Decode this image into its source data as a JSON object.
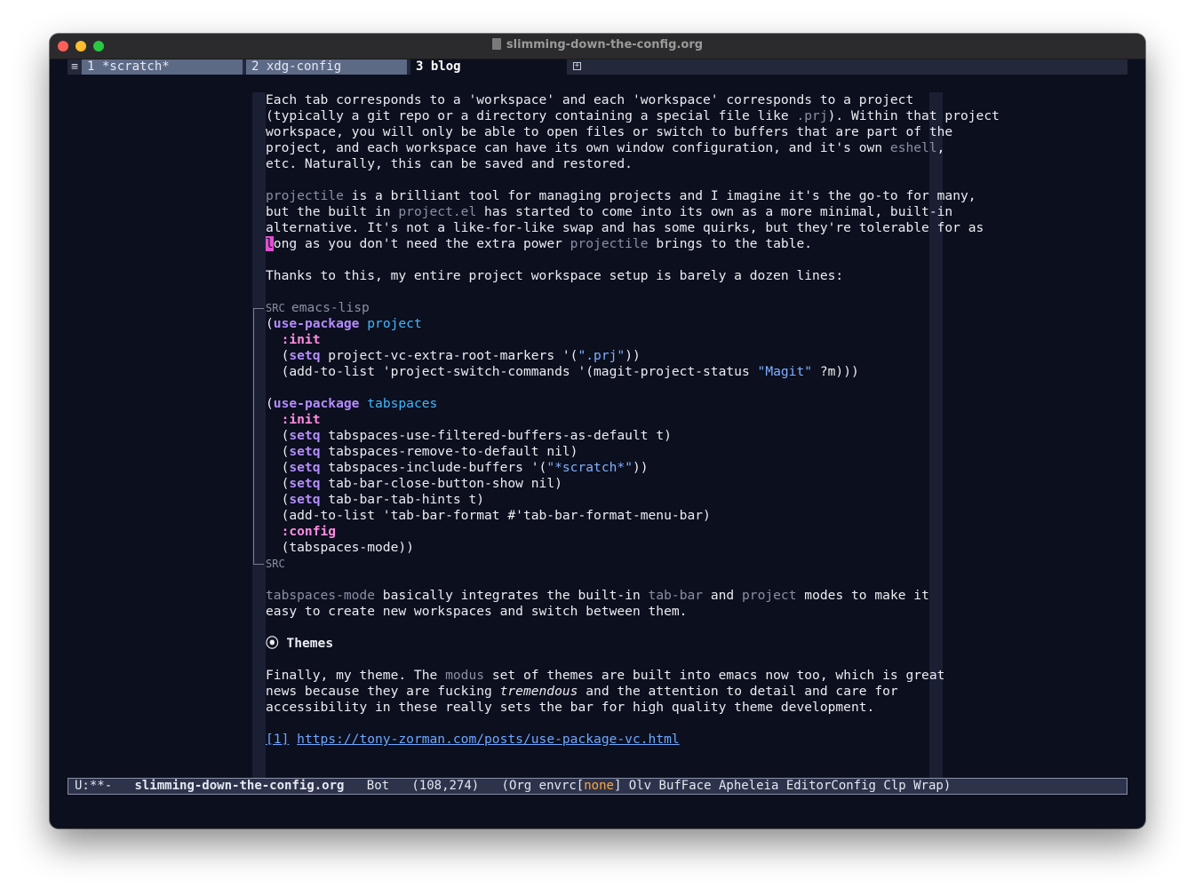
{
  "window": {
    "title": "slimming-down-the-config.org"
  },
  "tabs": [
    {
      "label": "1 *scratch*",
      "active": false
    },
    {
      "label": "2 xdg-config",
      "active": false
    },
    {
      "label": "3 blog",
      "active": true
    }
  ],
  "tabbar": {
    "menu_glyph": "≡",
    "add_glyph": "+"
  },
  "buffer": {
    "p1": [
      "Each tab corresponds to a 'workspace' and each 'workspace' corresponds to a project",
      [
        "(typically a git repo or a directory containing a special file like ",
        ".prj",
        "). Within that project"
      ],
      "workspace, you will only be able to open files or switch to buffers that are part of the",
      [
        "project, and each workspace can have its own window configuration, and it's own ",
        "eshell",
        ","
      ],
      "etc. Naturally, this can be saved and restored."
    ],
    "p2": [
      [
        "projectile",
        " is a brilliant tool for managing projects and I imagine it's the go-to for many,"
      ],
      [
        "but the built in ",
        "project.el",
        " has started to come into its own as a more minimal, built-in"
      ],
      "alternative. It's not a like-for-like swap and has some quirks, but they're tolerable for as",
      [
        "l",
        "ong as you don't need the extra power ",
        "projectile",
        " brings to the table."
      ]
    ],
    "p3": "Thanks to this, my entire project workspace setup is barely a dozen lines:",
    "src": {
      "begin_label": "SRC",
      "language": "emacs-lisp",
      "end_label": "SRC",
      "lines": [
        [
          "(",
          "use-package",
          " ",
          "project"
        ],
        [
          "  ",
          ":init"
        ],
        [
          "  (",
          "setq",
          " project-vc-extra-root-markers '(",
          "\".prj\"",
          "))"
        ],
        [
          "  (add-to-list 'project-switch-commands '(magit-project-status ",
          "\"Magit\"",
          " ?m)))"
        ],
        [
          ""
        ],
        [
          "(",
          "use-package",
          " ",
          "tabspaces"
        ],
        [
          "  ",
          ":init"
        ],
        [
          "  (",
          "setq",
          " tabspaces-use-filtered-buffers-as-default t)"
        ],
        [
          "  (",
          "setq",
          " tabspaces-remove-to-default nil)"
        ],
        [
          "  (",
          "setq",
          " tabspaces-include-buffers '(",
          "\"*scratch*\"",
          "))"
        ],
        [
          "  (",
          "setq",
          " tab-bar-close-button-show nil)"
        ],
        [
          "  (",
          "setq",
          " tab-bar-tab-hints t)"
        ],
        [
          "  (add-to-list 'tab-bar-format #'tab-bar-format-menu-bar)"
        ],
        [
          "  ",
          ":config"
        ],
        [
          "  (tabspaces-mode))"
        ]
      ]
    },
    "p4": [
      [
        "tabspaces-mode",
        " basically integrates the built-in ",
        "tab-bar",
        " and ",
        "project",
        " modes to make it"
      ],
      "easy to create new workspaces and switch between them."
    ],
    "heading": {
      "bullet": "⦿",
      "text": "Themes"
    },
    "p5": [
      [
        "Finally, my theme. The ",
        "modus",
        " set of themes are built into emacs now too, which is great"
      ],
      [
        "news because they are fucking ",
        "tremendous",
        " and the attention to detail and care for"
      ],
      "accessibility in these really sets the bar for high quality theme development."
    ],
    "footnote": {
      "label": "[1]",
      "url": "https://tony-zorman.com/posts/use-package-vc.html"
    }
  },
  "modeline": {
    "state": "U:**-",
    "buffer_name": "slimming-down-the-config.org",
    "position": "Bot",
    "coords": "(108,274)",
    "modes_prefix": "(Org envrc[",
    "envrc_status": "none",
    "modes_suffix": "] Olv BufFace Apheleia EditorConfig Clp Wrap)"
  },
  "colors": {
    "background": "#0c0f1e",
    "keyword": "#b48cff",
    "constant": "#ff8ce0",
    "function": "#40b6ff",
    "string": "#7fb0ff",
    "link": "#6ea8ff",
    "cursor": "#e050d0",
    "envrc_none": "#ffa53d"
  }
}
